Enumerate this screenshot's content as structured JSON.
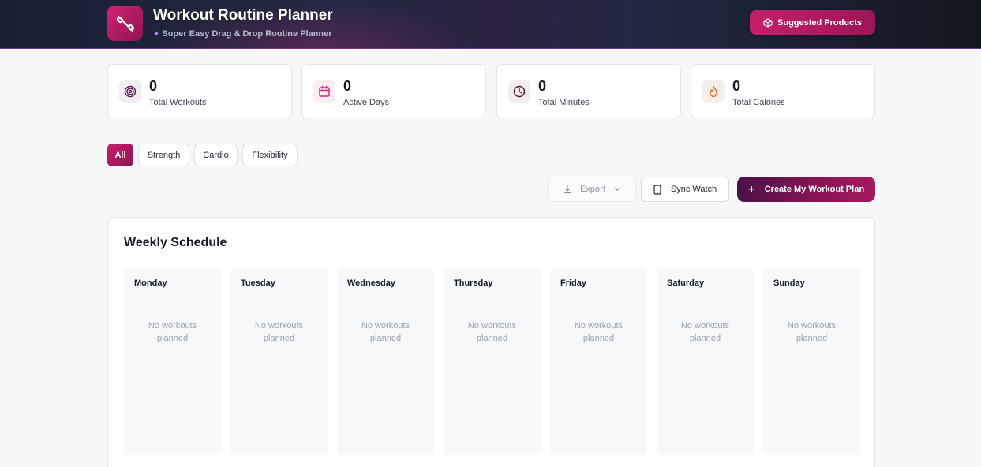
{
  "header": {
    "title": "Workout Routine Planner",
    "subtitle": "Super Easy Drag & Drop Routine Planner",
    "suggested_label": "Suggested Products"
  },
  "stats": [
    {
      "value": "0",
      "label": "Total Workouts",
      "icon": "target-icon"
    },
    {
      "value": "0",
      "label": "Active Days",
      "icon": "calendar-icon"
    },
    {
      "value": "0",
      "label": "Total Minutes",
      "icon": "clock-icon"
    },
    {
      "value": "0",
      "label": "Total Calories",
      "icon": "flame-icon"
    }
  ],
  "filters": [
    "All",
    "Strength",
    "Cardio",
    "Flexibility"
  ],
  "active_filter": "All",
  "actions": {
    "export_label": "Export",
    "sync_label": "Sync Watch",
    "create_label": "Create My Workout Plan"
  },
  "schedule": {
    "title": "Weekly Schedule",
    "empty_text": "No workouts planned",
    "days": [
      "Monday",
      "Tuesday",
      "Wednesday",
      "Thursday",
      "Friday",
      "Saturday",
      "Sunday"
    ]
  },
  "colors": {
    "brand": "#c61f69",
    "brand_dark": "#8e1454",
    "header_bg": "#1b1f33"
  }
}
